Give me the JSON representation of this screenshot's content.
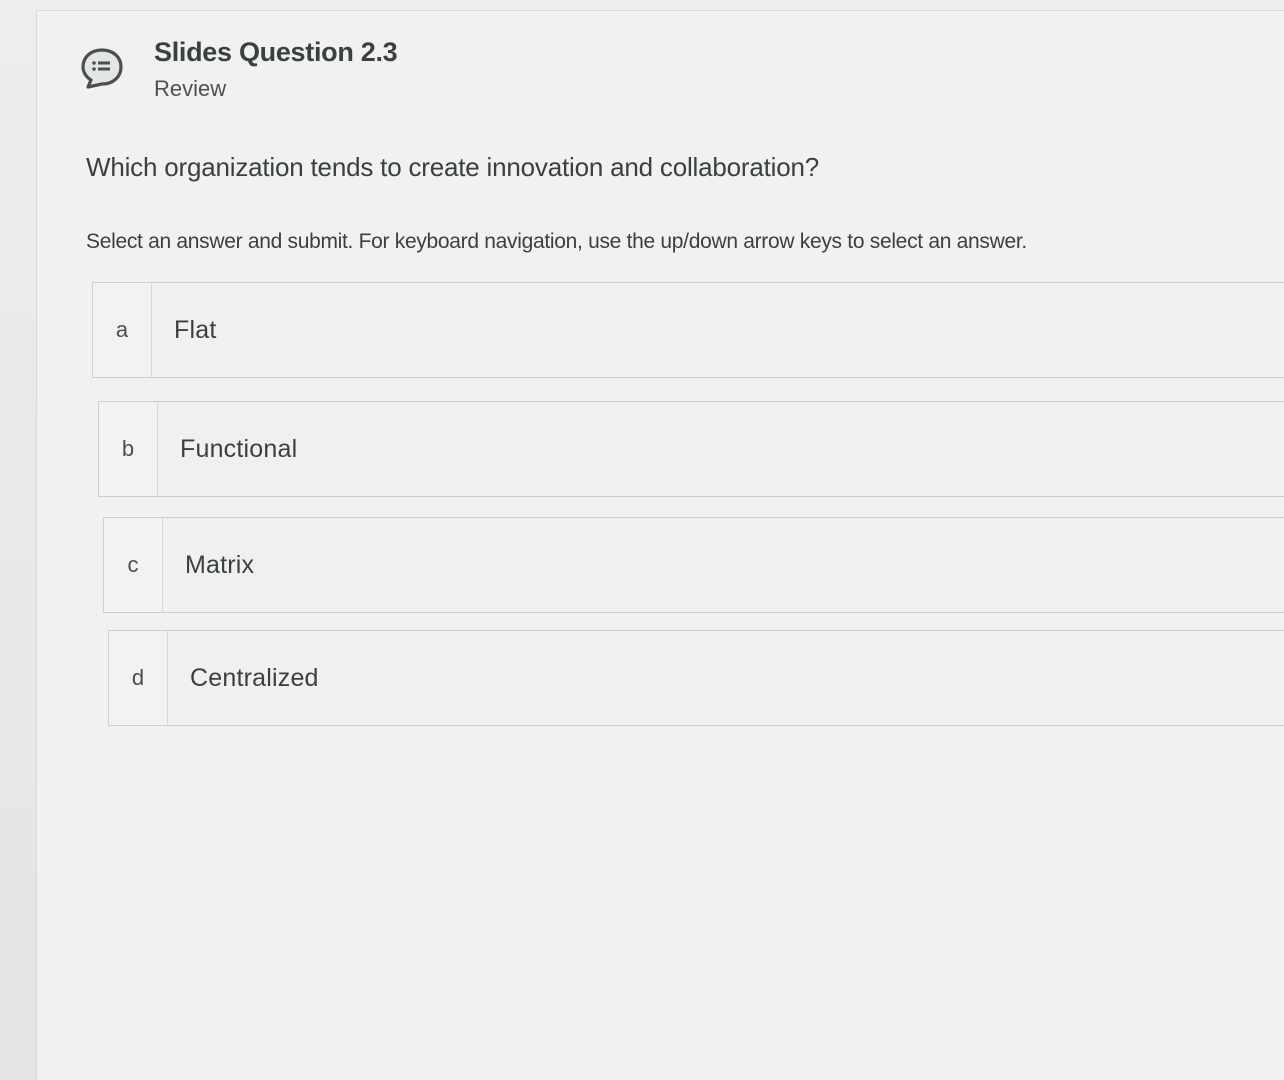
{
  "header": {
    "title": "Slides Question 2.3",
    "subtitle": "Review",
    "icon": "question-list-icon"
  },
  "question": {
    "text": "Which organization tends to create innovation and collaboration?",
    "instructions": "Select an answer and submit. For keyboard navigation, use the up/down arrow keys to select an answer."
  },
  "options": [
    {
      "letter": "a",
      "label": "Flat"
    },
    {
      "letter": "b",
      "label": "Functional"
    },
    {
      "letter": "c",
      "label": "Matrix"
    },
    {
      "letter": "d",
      "label": "Centralized"
    }
  ],
  "colors": {
    "background": "#f0f1f0",
    "text": "#3a3f42",
    "border": "#cdd0cd"
  }
}
